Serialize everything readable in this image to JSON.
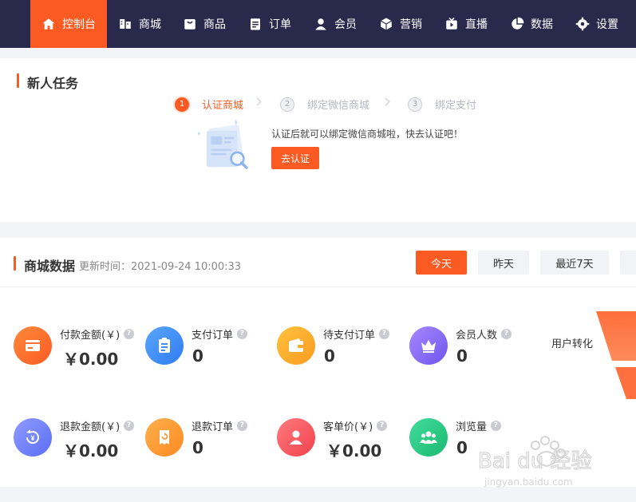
{
  "nav": {
    "items": [
      {
        "label": "控制台",
        "icon": "home-icon"
      },
      {
        "label": "商城",
        "icon": "shop-icon"
      },
      {
        "label": "商品",
        "icon": "goods-icon"
      },
      {
        "label": "订单",
        "icon": "order-icon"
      },
      {
        "label": "会员",
        "icon": "member-icon"
      },
      {
        "label": "营销",
        "icon": "marketing-icon"
      },
      {
        "label": "直播",
        "icon": "live-icon"
      },
      {
        "label": "数据",
        "icon": "data-icon"
      },
      {
        "label": "设置",
        "icon": "settings-icon"
      }
    ],
    "active_index": 0
  },
  "tasks": {
    "title": "新人任务",
    "steps": [
      {
        "num": "1",
        "label": "认证商城"
      },
      {
        "num": "2",
        "label": "绑定微信商城"
      },
      {
        "num": "3",
        "label": "绑定支付"
      }
    ],
    "hint": "认证后就可以绑定微信商城啦，快去认证吧！",
    "verify_button": "去认证"
  },
  "shop_data": {
    "title": "商城数据",
    "update_time": "更新时间：2021-09-24 10:00:33",
    "tabs": [
      "今天",
      "昨天",
      "最近7天"
    ],
    "active_tab": 0,
    "metrics": [
      {
        "label": "付款金额(￥)",
        "value": "￥0.00",
        "icon": "payment-card-icon",
        "color": "#fb6a2a"
      },
      {
        "label": "支付订单",
        "value": "0",
        "icon": "clipboard-icon",
        "color": "#3f8bf7"
      },
      {
        "label": "待支付订单",
        "value": "0",
        "icon": "wallet-icon",
        "color": "#fbab2b"
      },
      {
        "label": "会员人数",
        "value": "0",
        "icon": "crown-icon",
        "color": "#8b6cf6"
      },
      {
        "label": "退款金额(￥)",
        "value": "￥0.00",
        "icon": "refund-icon",
        "color": "#6f7dfb"
      },
      {
        "label": "退款订单",
        "value": "0",
        "icon": "refund-order-icon",
        "color": "#fb9a3a"
      },
      {
        "label": "客单价(￥)",
        "value": "￥0.00",
        "icon": "user-icon",
        "color": "#f8545c"
      },
      {
        "label": "浏览量",
        "value": "0",
        "icon": "group-icon",
        "color": "#27c784"
      }
    ],
    "funnel_label": "用户转化"
  },
  "watermark": {
    "text": "Bai du 经验",
    "sub": "jingyan.baidu.com"
  }
}
